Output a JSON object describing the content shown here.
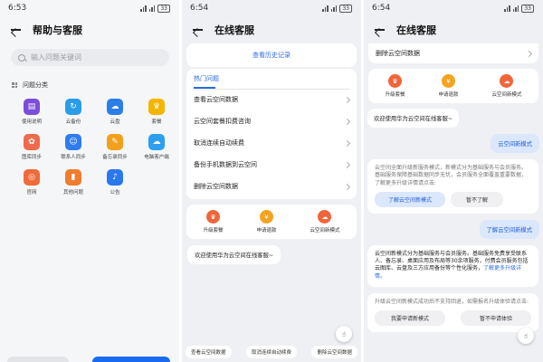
{
  "colors": {
    "accent": "#2c6ce0"
  },
  "panel1": {
    "time": "6:53",
    "battery": "33",
    "title": "帮助与客服",
    "search_placeholder": "输入问题关键词",
    "section_title": "问题分类",
    "categories": [
      {
        "label": "使用说明",
        "icon": "manual-icon",
        "color": "#7b4dd8",
        "glyph": "▤"
      },
      {
        "label": "云备份",
        "icon": "cloud-backup-icon",
        "color": "#2b9ce8",
        "glyph": "↻"
      },
      {
        "label": "云盘",
        "icon": "cloud-drive-icon",
        "color": "#2b7de8",
        "glyph": "☁"
      },
      {
        "label": "套餐",
        "icon": "crown-icon",
        "color": "#f5b400",
        "glyph": "♛"
      },
      {
        "label": "图库同步",
        "icon": "gallery-sync-icon",
        "color": "#ef6b4b",
        "glyph": "✿"
      },
      {
        "label": "联系人同步",
        "icon": "contacts-sync-icon",
        "color": "#2f7cf0",
        "glyph": "☺"
      },
      {
        "label": "备忘录同步",
        "icon": "notes-sync-icon",
        "color": "#f2a01c",
        "glyph": "✎"
      },
      {
        "label": "电脑客户端",
        "icon": "pc-client-icon",
        "color": "#2c9ff0",
        "glyph": "☁"
      },
      {
        "label": "官网",
        "icon": "website-icon",
        "color": "#f06a3a",
        "glyph": "◎"
      },
      {
        "label": "其他问题",
        "icon": "other-question-icon",
        "color": "#f07c2e",
        "glyph": "▮"
      },
      {
        "label": "公告",
        "icon": "notice-bell-icon",
        "color": "#2a78ee",
        "glyph": "♪"
      }
    ]
  },
  "panel2": {
    "time": "6:54",
    "battery": "33",
    "title": "在线客服",
    "history_link": "查看历史记录",
    "hot_title": "热门问题",
    "hot_items": [
      "查看云空间数据",
      "云空间套餐扣费咨询",
      "取消连续自动续费",
      "备份手机数据到云空间",
      "删除云空间数据"
    ],
    "quick_actions": [
      {
        "label": "升级套餐",
        "icon": "upgrade-crown-icon",
        "color": "#f0653a",
        "glyph": "♛"
      },
      {
        "label": "申请退款",
        "icon": "refund-icon",
        "color": "#f5a31f",
        "glyph": "¥"
      },
      {
        "label": "云空间新模式",
        "icon": "cloud-new-mode-icon",
        "color": "#f0653a",
        "glyph": "☁"
      }
    ],
    "welcome": "欢迎使用华为云空间在线客服~",
    "bottom_tags": [
      "查看云空间数据",
      "取消连续自动续费",
      "删除云空间数据"
    ]
  },
  "panel3": {
    "time": "6:54",
    "battery": "33",
    "title": "在线客服",
    "top_item": "删除云空间数据",
    "quick_actions": [
      {
        "label": "升级套餐",
        "icon": "upgrade-crown-icon",
        "color": "#f0653a",
        "glyph": "♛"
      },
      {
        "label": "申请退款",
        "icon": "refund-icon",
        "color": "#f5a31f",
        "glyph": "¥"
      },
      {
        "label": "云空间新模式",
        "icon": "cloud-new-mode-icon",
        "color": "#f0653a",
        "glyph": "☁"
      }
    ],
    "welcome": "欢迎使用华为云空间在线客服~",
    "user_msg1": "云空间新模式",
    "reply1": "云空间全面升级新服务模式，新模式分为基础服务与会员服务。基础服务保障基础数据同步无忧，会员服务全面覆盖重要数据，了解更多升级详情请点击:",
    "reply1_btn_primary": "了解云空间新模式",
    "reply1_btn_secondary": "暂不了解",
    "user_msg2": "了解云空间新模式",
    "reply2_main": "云空间新模式分为基础服务与会员服务。基础服务免费享受联系人、备忘录、桌面应用及布局等30余项服务，付费会员服务包括云图库、云盘及三方应用备份等个性化服务，",
    "reply2_link": "了解更多升级详情。",
    "reply3": "升级云空间新模式成功后不支持回退，如需报名升级体验请点击:",
    "reply3_btn1": "我要申请新模式",
    "reply3_btn2": "暂不申请体验"
  }
}
